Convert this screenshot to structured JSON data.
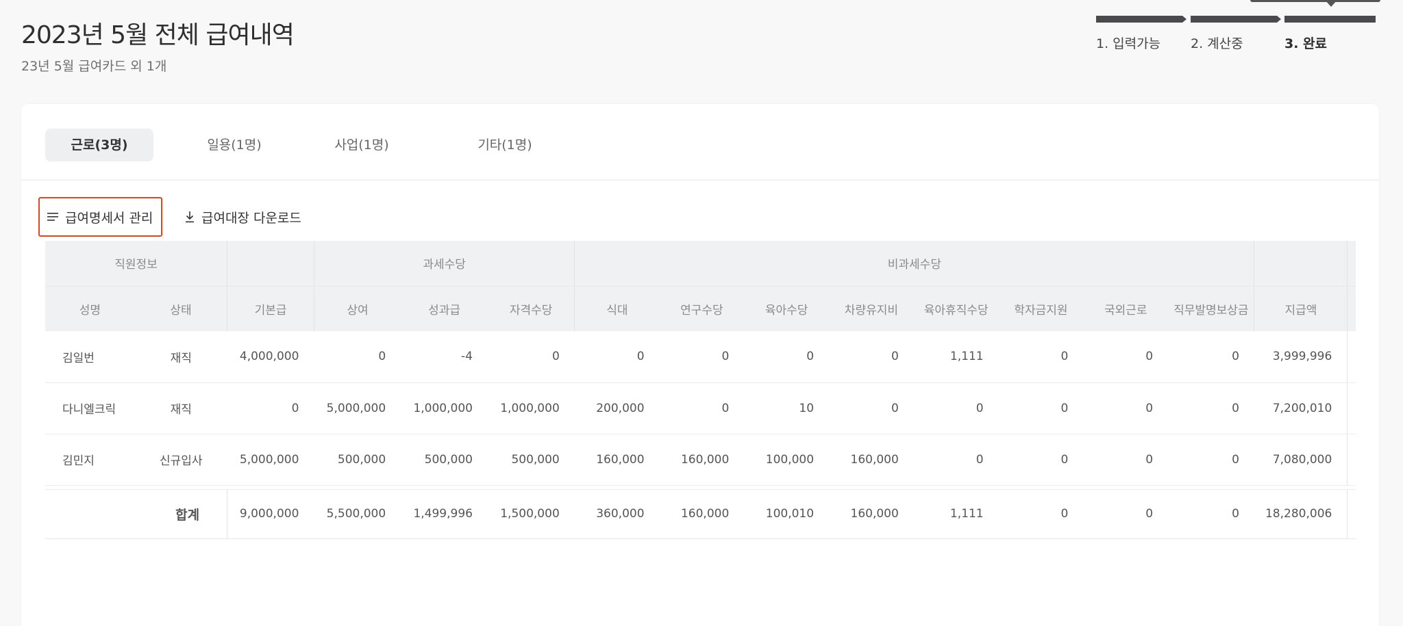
{
  "page": {
    "title": "2023년 5월 전체 급여내역",
    "subtitle": "23년 5월 급여카드 외 1개"
  },
  "steps": [
    {
      "label": "1. 입력가능",
      "active": false
    },
    {
      "label": "2. 계산중",
      "active": false
    },
    {
      "label": "3. 완료",
      "active": true
    }
  ],
  "tabs": [
    {
      "label": "근로(3명)",
      "active": true
    },
    {
      "label": "일용(1명)",
      "active": false
    },
    {
      "label": "사업(1명)",
      "active": false
    },
    {
      "label": "기타(1명)",
      "active": false
    }
  ],
  "toolbar": {
    "manage_label": "급여명세서 관리",
    "download_label": "급여대장 다운로드"
  },
  "table": {
    "groups": {
      "employee": "직원정보",
      "base": "",
      "taxable": "과세수당",
      "nontaxable": "비과세수당",
      "total": ""
    },
    "columns": [
      "성명",
      "상태",
      "기본급",
      "상여",
      "성과급",
      "자격수당",
      "식대",
      "연구수당",
      "육아수당",
      "차량유지비",
      "육아휴직수당",
      "학자금지원",
      "국외근로",
      "직무발명보상금",
      "지급액"
    ],
    "rows": [
      {
        "name": "김일번",
        "status": "재직",
        "values": [
          "4,000,000",
          "0",
          "-4",
          "0",
          "0",
          "0",
          "0",
          "0",
          "1,111",
          "0",
          "0",
          "0",
          "3,999,996"
        ]
      },
      {
        "name": "다니엘크릭",
        "status": "재직",
        "values": [
          "0",
          "5,000,000",
          "1,000,000",
          "1,000,000",
          "200,000",
          "0",
          "10",
          "0",
          "0",
          "0",
          "0",
          "0",
          "7,200,010"
        ]
      },
      {
        "name": "김민지",
        "status": "신규입사",
        "values": [
          "5,000,000",
          "500,000",
          "500,000",
          "500,000",
          "160,000",
          "160,000",
          "100,000",
          "160,000",
          "0",
          "0",
          "0",
          "0",
          "7,080,000"
        ]
      }
    ],
    "total": {
      "label": "합계",
      "values": [
        "9,000,000",
        "5,500,000",
        "1,499,996",
        "1,500,000",
        "360,000",
        "160,000",
        "100,010",
        "160,000",
        "1,111",
        "0",
        "0",
        "0",
        "18,280,006"
      ]
    }
  },
  "colors": {
    "highlight": "#e8431c",
    "step_bar": "#4a4a4e",
    "header_bg": "#f0f1f3"
  }
}
